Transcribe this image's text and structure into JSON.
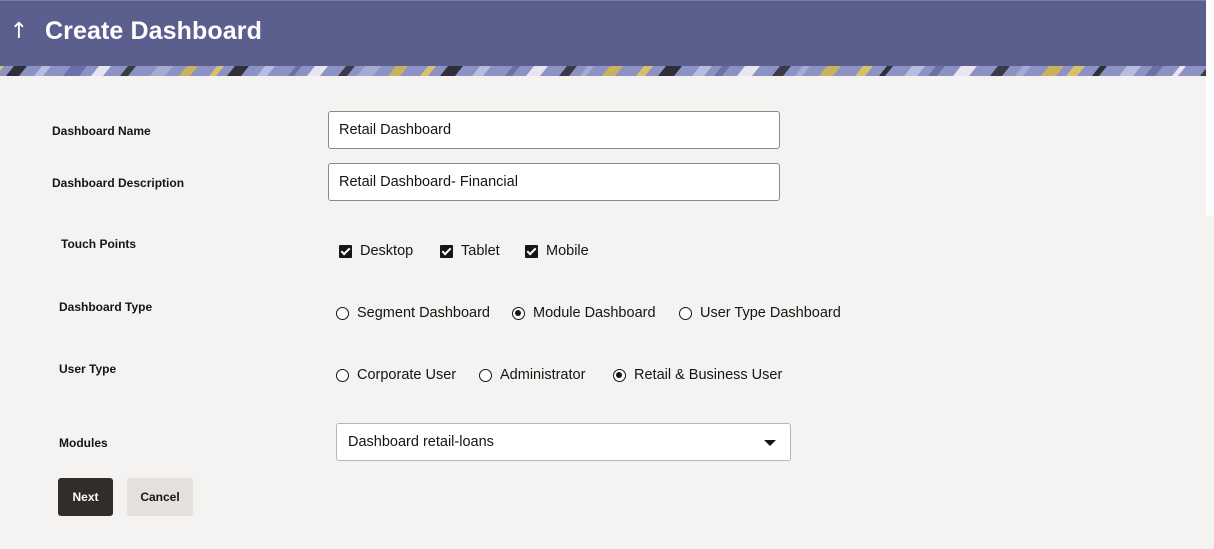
{
  "header": {
    "title": "Create Dashboard",
    "back_icon": "arrow-up-icon",
    "bar_color": "#5b5f8e"
  },
  "form": {
    "dashboard_name": {
      "label": "Dashboard Name",
      "value": "Retail Dashboard"
    },
    "dashboard_description": {
      "label": "Dashboard Description",
      "value": "Retail Dashboard- Financial"
    },
    "touch_points": {
      "label": "Touch Points",
      "options": [
        {
          "label": "Desktop",
          "checked": true
        },
        {
          "label": "Tablet",
          "checked": true
        },
        {
          "label": "Mobile",
          "checked": true
        }
      ]
    },
    "dashboard_type": {
      "label": "Dashboard Type",
      "options": [
        {
          "label": "Segment Dashboard",
          "selected": false
        },
        {
          "label": "Module Dashboard",
          "selected": true
        },
        {
          "label": "User Type Dashboard",
          "selected": false
        }
      ]
    },
    "user_type": {
      "label": "User Type",
      "options": [
        {
          "label": "Corporate User",
          "selected": false
        },
        {
          "label": "Administrator",
          "selected": false
        },
        {
          "label": "Retail & Business User",
          "selected": true
        }
      ]
    },
    "modules": {
      "label": "Modules",
      "selected": "Dashboard retail-loans"
    }
  },
  "actions": {
    "next_label": "Next",
    "cancel_label": "Cancel"
  }
}
